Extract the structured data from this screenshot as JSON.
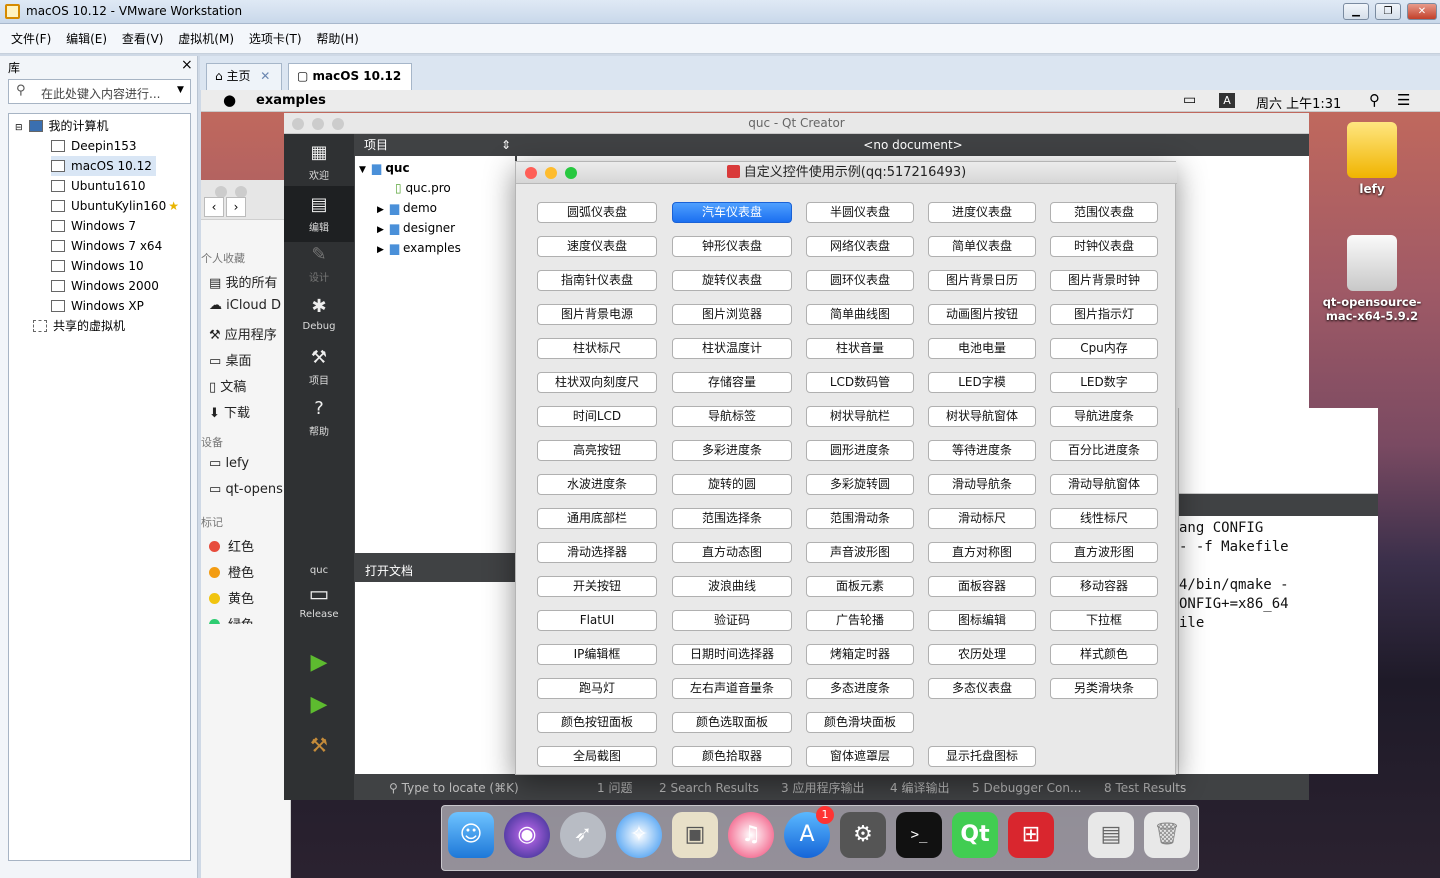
{
  "vm": {
    "title": "macOS 10.12 - VMware Workstation",
    "menu": [
      "文件(F)",
      "编辑(E)",
      "查看(V)",
      "虚拟机(M)",
      "选项卡(T)",
      "帮助(H)"
    ],
    "library": {
      "title": "库",
      "close": "×",
      "search_placeholder": "在此处键入内容进行...",
      "root": "我的计算机",
      "machines": [
        "Deepin153",
        "macOS 10.12",
        "Ubuntu1610",
        "UbuntuKylin160",
        "Windows 7",
        "Windows 7 x64",
        "Windows 10",
        "Windows 2000",
        "Windows XP"
      ],
      "shared": "共享的虚拟机"
    },
    "tabs": [
      {
        "label": "主页"
      },
      {
        "label": "macOS 10.12"
      }
    ]
  },
  "mac": {
    "app": "examples",
    "clock": "周六 上午1:31",
    "input_badge": "A",
    "finder": {
      "favorites_title": "个人收藏",
      "favorites": [
        "我的所有",
        "iCloud D",
        "应用程序",
        "桌面",
        "文稿",
        "下载"
      ],
      "devices_title": "设备",
      "devices": [
        "lefy",
        "qt-opens"
      ],
      "tags_title": "标记",
      "tags": [
        {
          "label": "红色",
          "color": "#e74c3c"
        },
        {
          "label": "橙色",
          "color": "#f39c12"
        },
        {
          "label": "黄色",
          "color": "#f1c40f"
        },
        {
          "label": "绿色",
          "color": "#2ecc71"
        }
      ]
    },
    "desktop": [
      {
        "label": "lefy"
      },
      {
        "label": "qt-opensource-mac-x64-5.9.2"
      }
    ]
  },
  "qtcreator": {
    "title": "quc - Qt Creator",
    "sidebar": [
      "欢迎",
      "编辑",
      "设计",
      "Debug",
      "项目",
      "帮助"
    ],
    "kit": {
      "project": "quc",
      "config": "Release"
    },
    "projects_label": "项目",
    "tree": {
      "root": "quc",
      "file": "quc.pro",
      "folders": [
        "demo",
        "designer",
        "examples"
      ]
    },
    "open_docs": "打开文档",
    "no_document": "<no document>",
    "locate_placeholder": "Type to locate (⌘K)",
    "bottom_tabs": [
      "1 问题",
      "2 Search Results",
      "3 应用程序输出",
      "4 编译输出",
      "5 Debugger Con...",
      "8 Test Results"
    ],
    "output_lines": [
      "ang CONFIG",
      "- -f Makefile",
      "",
      "4/bin/qmake -",
      "ONFIG+=x86_64",
      "ile"
    ]
  },
  "dialog": {
    "title": "自定义控件使用示例(qq:517216493)",
    "active": "汽车仪表盘",
    "rows": [
      [
        "圆弧仪表盘",
        "汽车仪表盘",
        "半圆仪表盘",
        "进度仪表盘",
        "范围仪表盘"
      ],
      [
        "速度仪表盘",
        "钟形仪表盘",
        "网络仪表盘",
        "简单仪表盘",
        "时钟仪表盘"
      ],
      [
        "指南针仪表盘",
        "旋转仪表盘",
        "圆环仪表盘",
        "图片背景日历",
        "图片背景时钟"
      ],
      [
        "图片背景电源",
        "图片浏览器",
        "简单曲线图",
        "动画图片按钮",
        "图片指示灯"
      ],
      [
        "柱状标尺",
        "柱状温度计",
        "柱状音量",
        "电池电量",
        "Cpu内存"
      ],
      [
        "柱状双向刻度尺",
        "存储容量",
        "LCD数码管",
        "LED字模",
        "LED数字"
      ],
      [
        "时间LCD",
        "导航标签",
        "树状导航栏",
        "树状导航窗体",
        "导航进度条"
      ],
      [
        "高亮按钮",
        "多彩进度条",
        "圆形进度条",
        "等待进度条",
        "百分比进度条"
      ],
      [
        "水波进度条",
        "旋转的圆",
        "多彩旋转圆",
        "滑动导航条",
        "滑动导航窗体"
      ],
      [
        "通用底部栏",
        "范围选择条",
        "范围滑动条",
        "滑动标尺",
        "线性标尺"
      ],
      [
        "滑动选择器",
        "直方动态图",
        "声音波形图",
        "直方对称图",
        "直方波形图"
      ],
      [
        "开关按钮",
        "波浪曲线",
        "面板元素",
        "面板容器",
        "移动容器"
      ],
      [
        "FlatUI",
        "验证码",
        "广告轮播",
        "图标编辑",
        "下拉框"
      ],
      [
        "IP编辑框",
        "日期时间选择器",
        "烤箱定时器",
        "农历处理",
        "样式颜色"
      ],
      [
        "跑马灯",
        "左右声道音量条",
        "多态进度条",
        "多态仪表盘",
        "另类滑块条"
      ],
      [
        "颜色按钮面板",
        "颜色选取面板",
        "颜色滑块面板"
      ],
      [
        "全局截图",
        "颜色拾取器",
        "窗体遮罩层",
        "显示托盘图标"
      ]
    ]
  },
  "dock": {
    "badge": "1"
  }
}
